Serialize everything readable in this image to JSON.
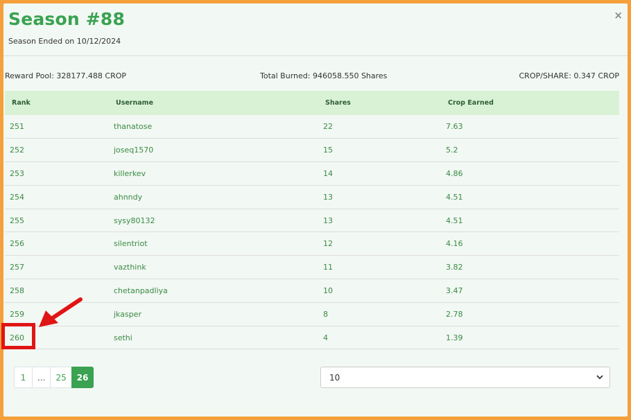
{
  "modal": {
    "title": "Season #88",
    "subtitle": "Season Ended on 10/12/2024",
    "close_icon": "×"
  },
  "stats": {
    "reward_pool": "Reward Pool: 328177.488 CROP",
    "total_burned": "Total Burned: 946058.550 Shares",
    "crop_per_share": "CROP/SHARE: 0.347 CROP"
  },
  "table": {
    "headers": [
      "Rank",
      "Username",
      "Shares",
      "Crop Earned"
    ],
    "rows": [
      [
        "251",
        "thanatose",
        "22",
        "7.63"
      ],
      [
        "252",
        "joseq1570",
        "15",
        "5.2"
      ],
      [
        "253",
        "killerkev",
        "14",
        "4.86"
      ],
      [
        "254",
        "ahnndy",
        "13",
        "4.51"
      ],
      [
        "255",
        "sysy80132",
        "13",
        "4.51"
      ],
      [
        "256",
        "silentriot",
        "12",
        "4.16"
      ],
      [
        "257",
        "vazthink",
        "11",
        "3.82"
      ],
      [
        "258",
        "chetanpadliya",
        "10",
        "3.47"
      ],
      [
        "259",
        "jkasper",
        "8",
        "2.78"
      ],
      [
        "260",
        "sethi",
        "4",
        "1.39"
      ]
    ]
  },
  "pagination": {
    "pages": [
      "1",
      "...",
      "25",
      "26"
    ],
    "active": "26"
  },
  "page_size": {
    "selected": "10"
  },
  "colors": {
    "accent": "#3aa251",
    "annotation": "#e01515",
    "frame": "#f5a03a"
  }
}
